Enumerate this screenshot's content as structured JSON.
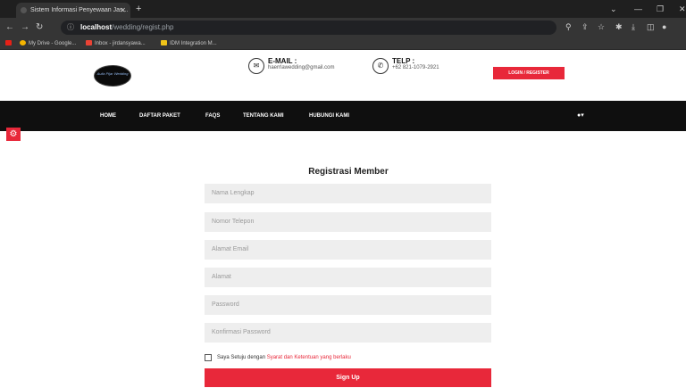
{
  "browser": {
    "tab_title": "Sistem Informasi Penyewaan Jas...",
    "url_host": "localhost",
    "url_path": "/wedding/regist.php",
    "bookmarks": [
      "My Drive - Google...",
      "Inbox - jirdansyawa...",
      "IDM Integration M..."
    ]
  },
  "header": {
    "logo_text": "Aulia Pijar Wedding",
    "email_title": "E-MAIL :",
    "email_value": "haerrlawedding@gmail.com",
    "phone_title": "TELP :",
    "phone_value": "+62 821-1079-2921",
    "login_label": "LOGIN / REGISTER"
  },
  "nav": {
    "items": [
      "HOME",
      "DAFTAR PAKET",
      "FAQS",
      "TENTANG KAMI",
      "HUBUNGI KAMI"
    ]
  },
  "form": {
    "title": "Registrasi Member",
    "fields": [
      "Nama Lengkap",
      "Nomor Telepon",
      "Alamat Email",
      "Alamat",
      "Password",
      "Konfirmasi Password"
    ],
    "terms_text": "Saya Setuju dengan ",
    "terms_link": "Syarat dan Ketentuan yang berlaku",
    "submit_label": "Sign Up"
  },
  "colors": {
    "accent": "#e8283a",
    "nav_bg": "#0f0f0f",
    "field_bg": "#eeeeee"
  }
}
